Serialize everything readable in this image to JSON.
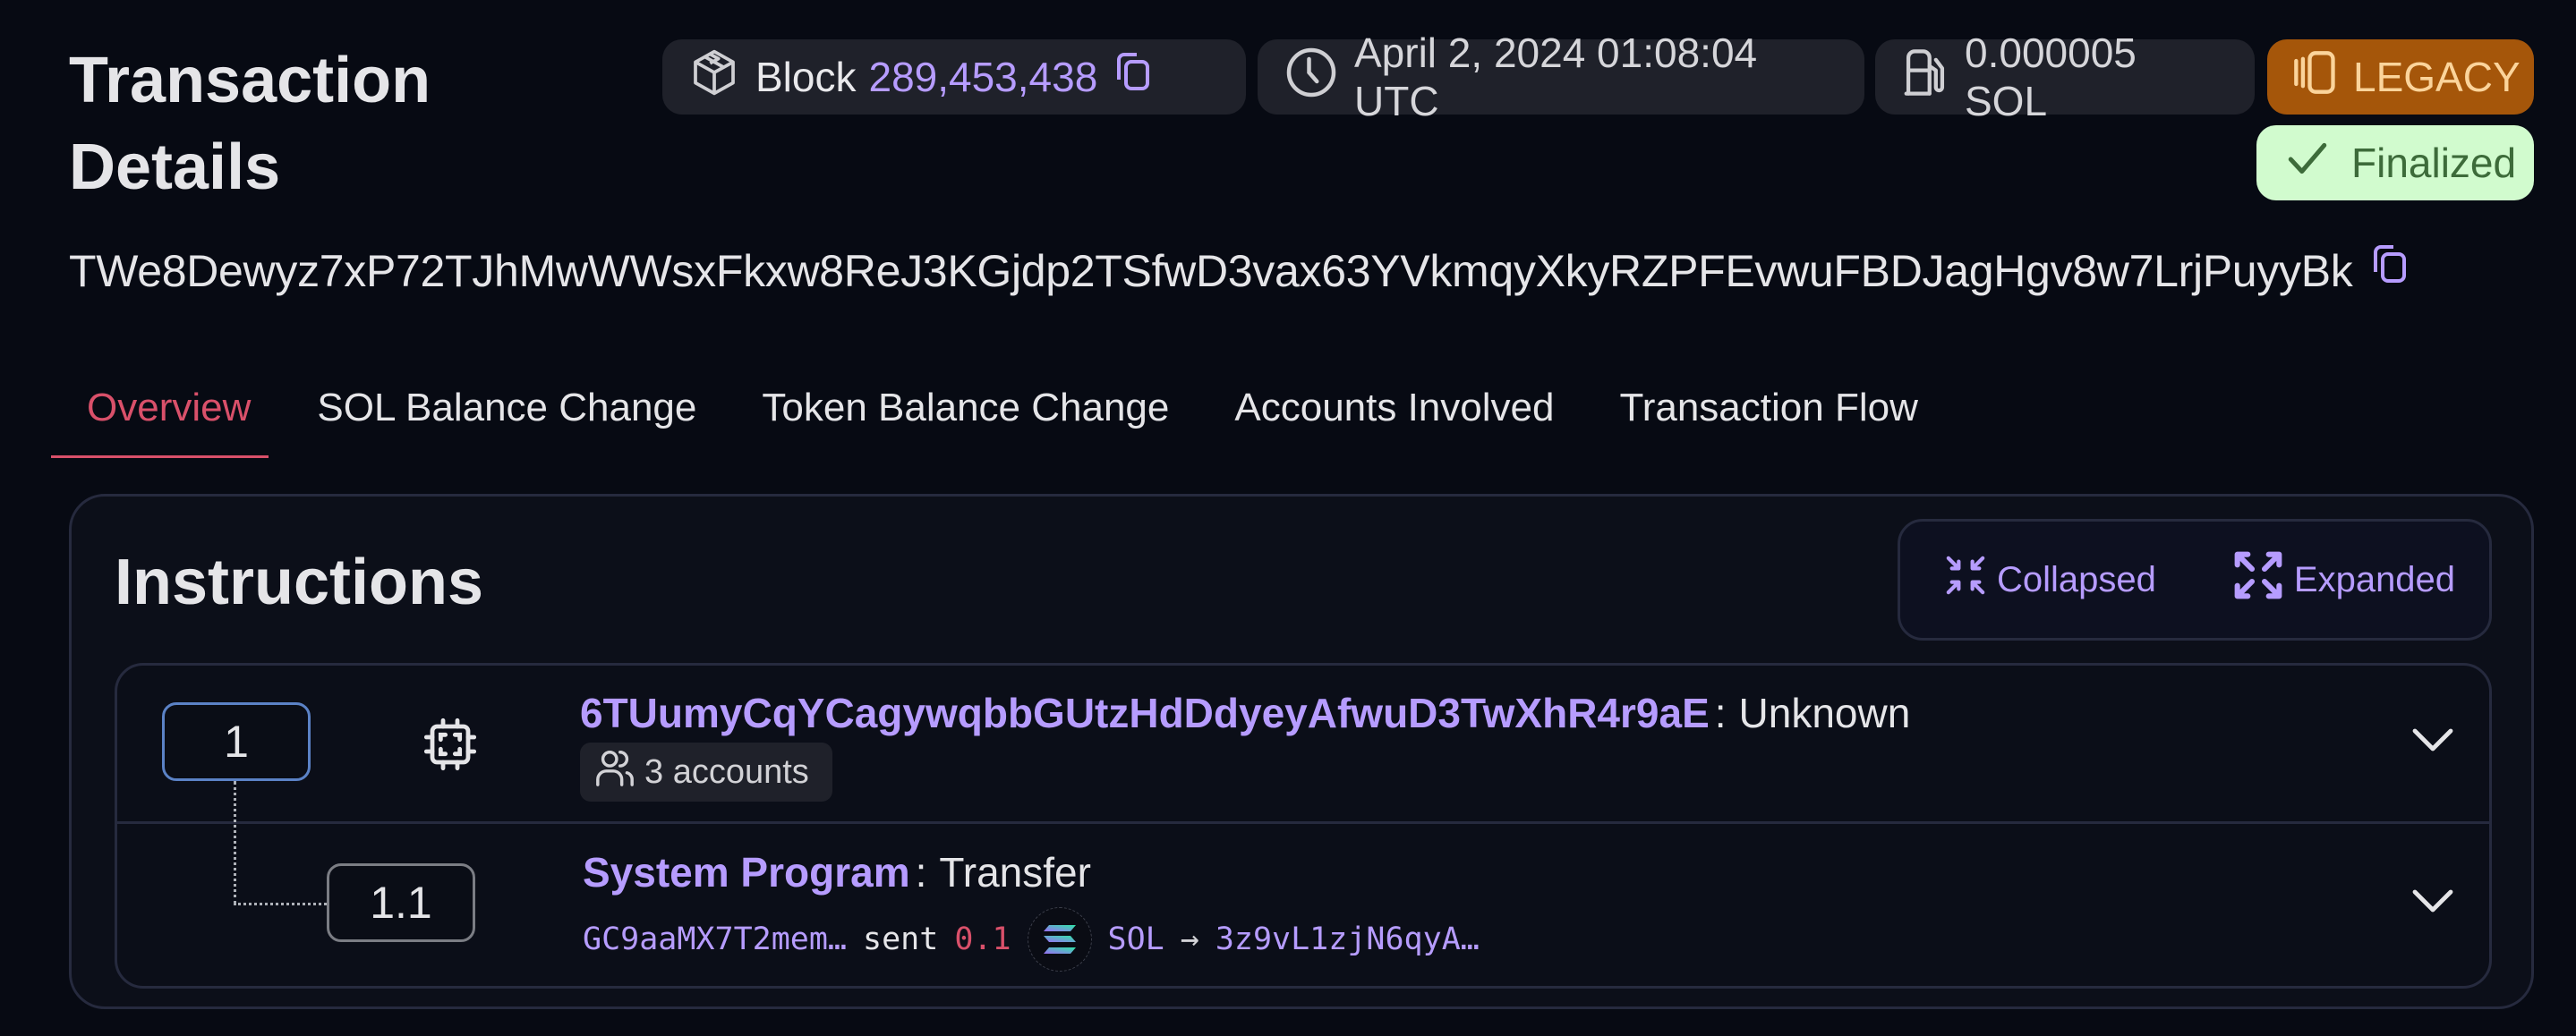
{
  "header": {
    "title": "Transaction Details",
    "block_label": "Block",
    "block_number": "289,453,438",
    "timestamp": "April 2, 2024 01:08:04 UTC",
    "fee": "0.000005 SOL",
    "version_badge": "LEGACY",
    "status_badge": "Finalized",
    "signature": "TWe8Dewyz7xP72TJhMwWWsxFkxw8ReJ3KGjdp2TSfwD3vax63YVkmqyXkyRZPFEvwuFBDJagHgv8w7LrjPuyyBk"
  },
  "tabs": [
    {
      "label": "Overview",
      "active": true
    },
    {
      "label": "SOL Balance Change",
      "active": false
    },
    {
      "label": "Token Balance Change",
      "active": false
    },
    {
      "label": "Accounts Involved",
      "active": false
    },
    {
      "label": "Transaction Flow",
      "active": false
    }
  ],
  "instructions": {
    "title": "Instructions",
    "view_toggle": {
      "collapsed_label": "Collapsed",
      "expanded_label": "Expanded"
    },
    "items": [
      {
        "index": "1",
        "program": "6TUumyCqYCagywqbbGUtzHdDdyeyAfwuD3TwXhR4r9aE",
        "separator": ":",
        "type": "Unknown",
        "accounts_label": "3 accounts"
      },
      {
        "index": "1.1",
        "program": "System Program",
        "separator": ":",
        "type": "Transfer",
        "transfer": {
          "from": "GC9aaMX7T2mem…",
          "verb": "sent",
          "amount": "0.1",
          "token": "SOL",
          "arrow": "→",
          "to": "3z9vL1zjN6qyA…"
        }
      }
    ]
  },
  "colors": {
    "accent_purple": "#b69cff",
    "active_tab": "#d9506a",
    "legacy_bg": "#a5560a",
    "finalized_bg": "#d1fbce"
  }
}
